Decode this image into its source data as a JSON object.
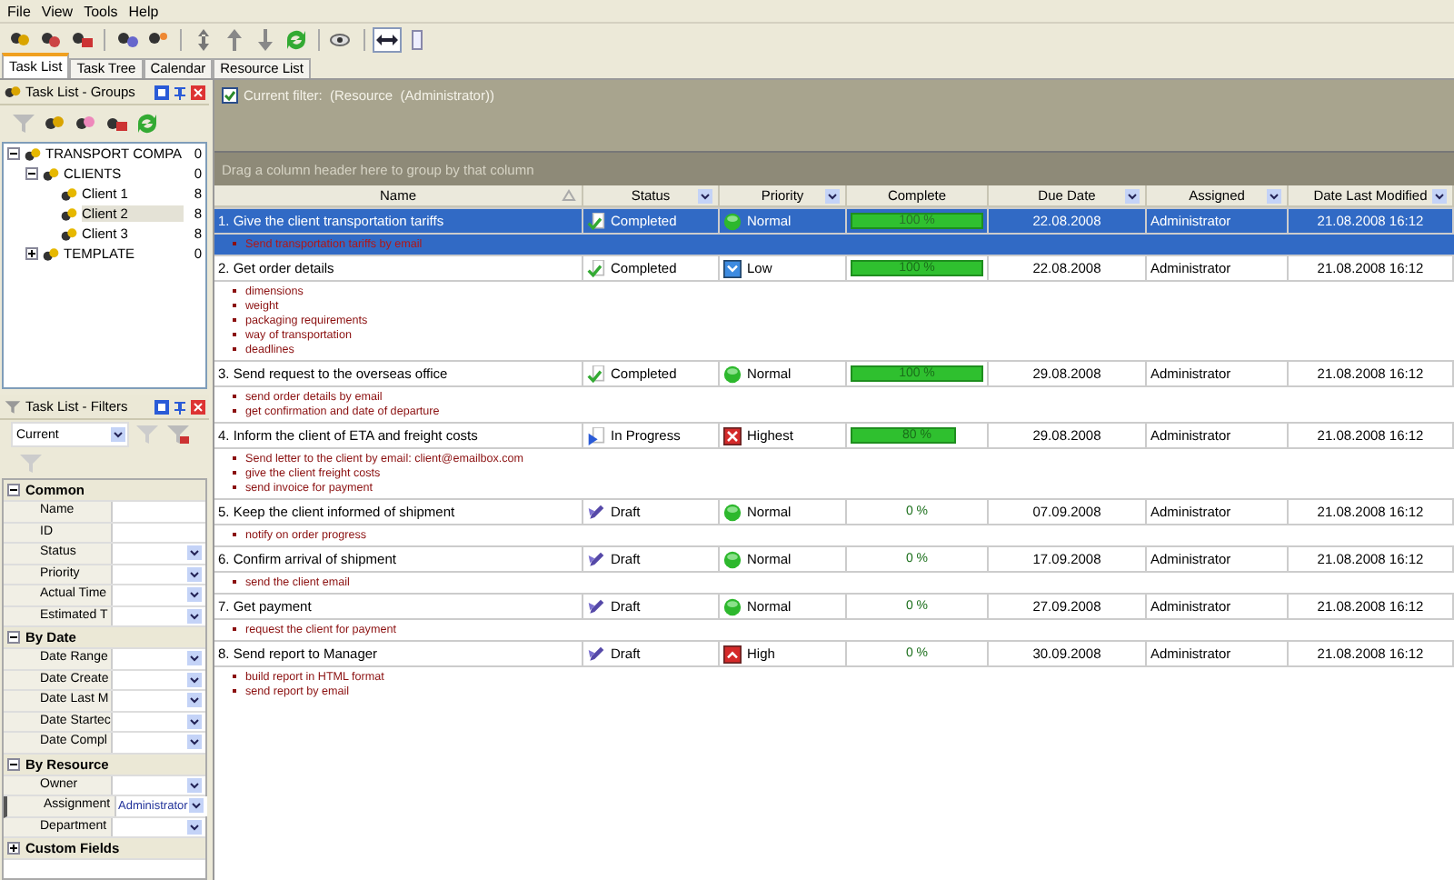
{
  "menu": [
    "File",
    "View",
    "Tools",
    "Help"
  ],
  "tabs": [
    {
      "label": "Task List",
      "selected": true
    },
    {
      "label": "Task Tree",
      "selected": false
    },
    {
      "label": "Calendar",
      "selected": false
    },
    {
      "label": "Resource List",
      "selected": false
    }
  ],
  "groups_panel": {
    "title": "Task List - Groups",
    "tree": [
      {
        "label": "TRANSPORT COMPA",
        "count": "0",
        "expanded": true,
        "selected": false,
        "children": [
          {
            "label": "CLIENTS",
            "count": "0",
            "expanded": true,
            "selected": false,
            "children": [
              {
                "label": "Client 1",
                "count": "8",
                "selected": false
              },
              {
                "label": "Client 2",
                "count": "8",
                "selected": true
              },
              {
                "label": "Client 3",
                "count": "8",
                "selected": false
              }
            ]
          },
          {
            "label": "TEMPLATE",
            "count": "0",
            "expanded": false,
            "selected": false
          }
        ]
      }
    ]
  },
  "filters_panel": {
    "title": "Task List - Filters",
    "current": "Current",
    "sections": [
      {
        "title": "Common",
        "expanded": true,
        "fields": [
          {
            "name": "Name",
            "dropdown": false,
            "selected": false
          },
          {
            "name": "ID",
            "dropdown": false,
            "selected": false
          },
          {
            "name": "Status",
            "dropdown": true,
            "selected": false
          },
          {
            "name": "Priority",
            "dropdown": true,
            "selected": false
          },
          {
            "name": "Actual Time",
            "dropdown": true,
            "selected": false
          },
          {
            "name": "Estimated T",
            "dropdown": true,
            "selected": false
          }
        ]
      },
      {
        "title": "By Date",
        "expanded": true,
        "fields": [
          {
            "name": "Date Range",
            "dropdown": true,
            "selected": false
          },
          {
            "name": "Date Create",
            "dropdown": true,
            "selected": false
          },
          {
            "name": "Date Last M",
            "dropdown": true,
            "selected": false
          },
          {
            "name": "Date Startec",
            "dropdown": true,
            "selected": false
          },
          {
            "name": "Date Compl",
            "dropdown": true,
            "selected": false
          }
        ]
      },
      {
        "title": "By Resource",
        "expanded": true,
        "fields": [
          {
            "name": "Owner",
            "dropdown": true,
            "selected": false
          },
          {
            "name": "Assignment",
            "value": "Administrator",
            "dropdown": true,
            "selected": true
          },
          {
            "name": "Department",
            "dropdown": true,
            "selected": false
          }
        ]
      },
      {
        "title": "Custom Fields",
        "expanded": false
      }
    ]
  },
  "filter_bar": {
    "checked": true,
    "text": "Current filter:  (Resource  (Administrator))"
  },
  "group_hint": "Drag a column header here to group by that column",
  "table": {
    "columns": [
      {
        "label": "Name",
        "kind": "sort"
      },
      {
        "label": "Status",
        "kind": "filter"
      },
      {
        "label": "Priority",
        "kind": "filter"
      },
      {
        "label": "Complete",
        "kind": "plain"
      },
      {
        "label": "Due Date",
        "kind": "filter"
      },
      {
        "label": "Assigned",
        "kind": "filter"
      },
      {
        "label": "Date Last Modified",
        "kind": "filter"
      }
    ],
    "rows": [
      {
        "name": "1. Give the client transportation tariffs",
        "status": {
          "label": "Completed",
          "kind": "completed"
        },
        "priority": {
          "label": "Normal",
          "kind": "normal"
        },
        "level": 1,
        "complete": "100 %",
        "due": "22.08.2008",
        "assigned": "Administrator",
        "modified": "21.08.2008 16:12",
        "selected": true,
        "subtasks": [
          "Send transportation tariffs by email"
        ]
      },
      {
        "name": "2. Get order details",
        "status": {
          "label": "Completed",
          "kind": "completed"
        },
        "priority": {
          "label": "Low",
          "kind": "low"
        },
        "level": 1,
        "complete": "100 %",
        "due": "22.08.2008",
        "assigned": "Administrator",
        "modified": "21.08.2008 16:12",
        "selected": false,
        "subtasks": [
          "dimensions",
          "weight",
          "packaging requirements",
          "way of transportation",
          "deadlines"
        ]
      },
      {
        "name": "3. Send request to the overseas office",
        "status": {
          "label": "Completed",
          "kind": "completed"
        },
        "priority": {
          "label": "Normal",
          "kind": "normal"
        },
        "level": 1,
        "complete": "100 %",
        "due": "29.08.2008",
        "assigned": "Administrator",
        "modified": "21.08.2008 16:12",
        "selected": false,
        "subtasks": [
          "send order details by email",
          "get confirmation and date of departure"
        ]
      },
      {
        "name": "4. Inform the client of ETA and freight costs",
        "status": {
          "label": "In Progress",
          "kind": "in_progress"
        },
        "priority": {
          "label": "Highest",
          "kind": "highest"
        },
        "level": 0.8,
        "complete": "80 %",
        "due": "29.08.2008",
        "assigned": "Administrator",
        "modified": "21.08.2008 16:12",
        "selected": false,
        "subtasks": [
          "Send letter to the client by email: client@emailbox.com",
          "give the client freight costs",
          "send invoice for payment"
        ]
      },
      {
        "name": "5. Keep the client informed of shipment",
        "status": {
          "label": "Draft",
          "kind": "draft"
        },
        "priority": {
          "label": "Normal",
          "kind": "normal"
        },
        "complete": "0 %",
        "due": "07.09.2008",
        "assigned": "Administrator",
        "modified": "21.08.2008 16:12",
        "selected": false,
        "subtasks": [
          "notify on order progress"
        ]
      },
      {
        "name": "6. Confirm arrival of shipment",
        "status": {
          "label": "Draft",
          "kind": "draft"
        },
        "priority": {
          "label": "Normal",
          "kind": "normal"
        },
        "complete": "0 %",
        "due": "17.09.2008",
        "assigned": "Administrator",
        "modified": "21.08.2008 16:12",
        "selected": false,
        "subtasks": [
          "send the client email"
        ]
      },
      {
        "name": "7. Get payment",
        "status": {
          "label": "Draft",
          "kind": "draft"
        },
        "priority": {
          "label": "Normal",
          "kind": "normal"
        },
        "complete": "0 %",
        "due": "27.09.2008",
        "assigned": "Administrator",
        "modified": "21.08.2008 16:12",
        "selected": false,
        "subtasks": [
          "request the client for payment"
        ]
      },
      {
        "name": "8. Send report to Manager",
        "status": {
          "label": "Draft",
          "kind": "draft"
        },
        "priority": {
          "label": "High",
          "kind": "high"
        },
        "complete": "0 %",
        "due": "30.09.2008",
        "assigned": "Administrator",
        "modified": "21.08.2008 16:12",
        "selected": false,
        "subtasks": [
          "build report in HTML format",
          "send report by email"
        ]
      }
    ]
  }
}
